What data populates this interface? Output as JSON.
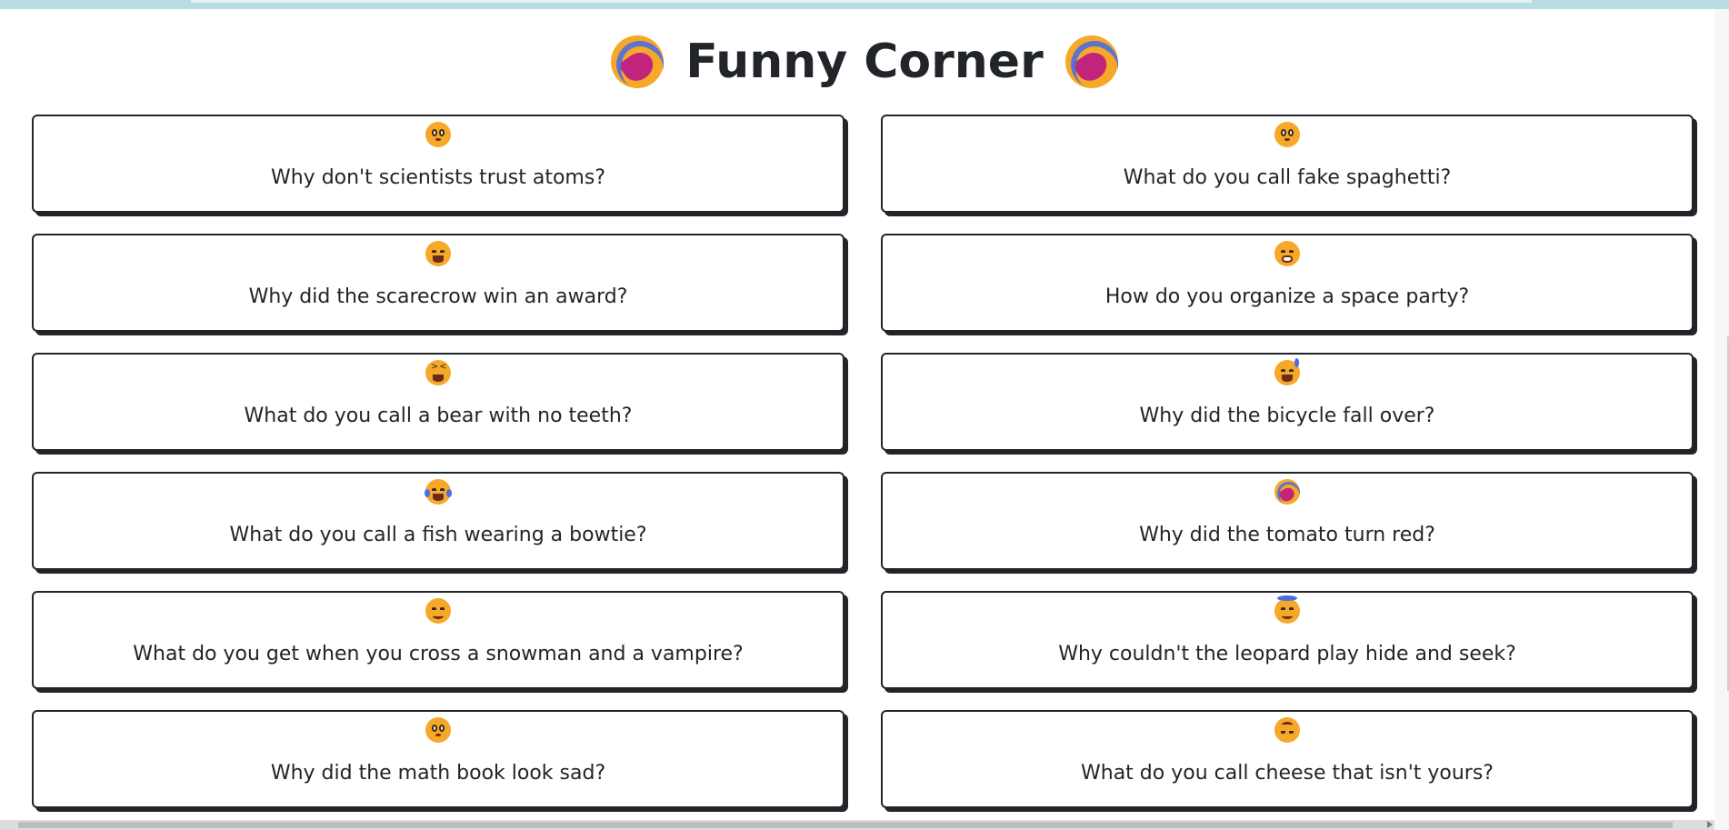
{
  "page": {
    "title": "Funny Corner",
    "title_icon_left": "rolling-on-floor-laughing-icon",
    "title_icon_right": "rolling-on-floor-laughing-icon"
  },
  "colors": {
    "accent_top_bar": "#b7dde3",
    "card_border": "#212529",
    "emoji_yellow": "#f6a828"
  },
  "jokes": [
    {
      "question": "Why don't scientists trust atoms?",
      "icon": "flushed-face-icon"
    },
    {
      "question": "What do you call fake spaghetti?",
      "icon": "flushed-face-icon"
    },
    {
      "question": "Why did the scarecrow win an award?",
      "icon": "grinning-face-icon"
    },
    {
      "question": "How do you organize a space party?",
      "icon": "grinning-teeth-face-icon"
    },
    {
      "question": "What do you call a bear with no teeth?",
      "icon": "squinting-face-icon"
    },
    {
      "question": "Why did the bicycle fall over?",
      "icon": "grinning-sweat-face-icon"
    },
    {
      "question": "What do you call a fish wearing a bowtie?",
      "icon": "tears-of-joy-face-icon"
    },
    {
      "question": "Why did the tomato turn red?",
      "icon": "rolling-on-floor-laughing-icon"
    },
    {
      "question": "What do you get when you cross a snowman and a vampire?",
      "icon": "smiling-face-icon"
    },
    {
      "question": "Why couldn't the leopard play hide and seek?",
      "icon": "halo-face-icon"
    },
    {
      "question": "Why did the math book look sad?",
      "icon": "flushed-face-icon"
    },
    {
      "question": "What do you call cheese that isn't yours?",
      "icon": "upside-down-face-icon"
    }
  ]
}
